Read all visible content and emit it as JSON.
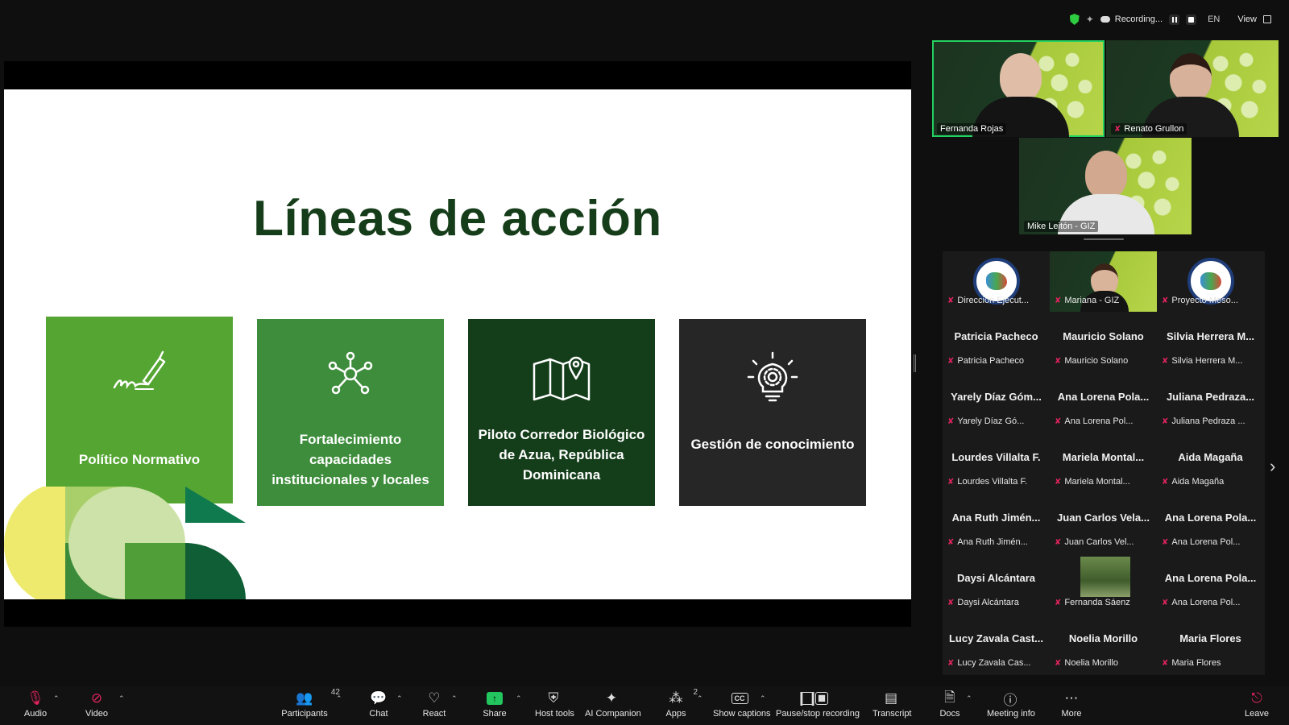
{
  "topbar": {
    "recording": "Recording...",
    "language": "EN",
    "view": "View"
  },
  "slide": {
    "title": "Líneas de acción",
    "cards": [
      {
        "label": "Político Normativo",
        "icon": "signature-pen-icon"
      },
      {
        "label": "Fortalecimiento capacidades institucionales y locales",
        "icon": "network-nodes-icon"
      },
      {
        "label": "Piloto Corredor Biológico de Azua, República Dominicana",
        "icon": "map-pin-icon"
      },
      {
        "label": "Gestión de conocimiento",
        "icon": "lightbulb-gear-icon"
      }
    ],
    "colors": {
      "title": "#163d1a",
      "card1": "#55a533",
      "card2": "#3e8d3c",
      "card3": "#143d1a",
      "card4": "#262626"
    }
  },
  "video_tiles": [
    {
      "name": "Fernanda Rojas",
      "active": true
    },
    {
      "name": "Renato Grullon",
      "muted": true
    },
    {
      "name": "Mike Leitón - GIZ"
    }
  ],
  "gallery": [
    {
      "big": "",
      "small": "Dirección Ejecut...",
      "type": "logo"
    },
    {
      "big": "",
      "small": "Mariana - GIZ",
      "type": "video"
    },
    {
      "big": "",
      "small": "Proyecto Meso...",
      "type": "logo"
    },
    {
      "big": "Patricia Pacheco",
      "small": "Patricia Pacheco"
    },
    {
      "big": "Mauricio Solano",
      "small": "Mauricio Solano"
    },
    {
      "big": "Silvia Herrera M...",
      "small": "Silvia Herrera M..."
    },
    {
      "big": "Yarely Díaz Góm...",
      "small": "Yarely Díaz Gó..."
    },
    {
      "big": "Ana Lorena Pola...",
      "small": "Ana Lorena Pol..."
    },
    {
      "big": "Juliana Pedraza...",
      "small": "Juliana Pedraza ..."
    },
    {
      "big": "Lourdes Villalta F.",
      "small": "Lourdes Villalta F."
    },
    {
      "big": "Mariela Montal...",
      "small": "Mariela Montal..."
    },
    {
      "big": "Aida Magaña",
      "small": "Aida Magaña"
    },
    {
      "big": "Ana Ruth Jimén...",
      "small": "Ana Ruth Jimén..."
    },
    {
      "big": "Juan Carlos Vela...",
      "small": "Juan Carlos Vel..."
    },
    {
      "big": "Ana Lorena Pola...",
      "small": "Ana Lorena Pol..."
    },
    {
      "big": "Daysi Alcántara",
      "small": "Daysi Alcántara"
    },
    {
      "big": "",
      "small": "Fernanda Sáenz",
      "type": "photo"
    },
    {
      "big": "Ana Lorena Pola...",
      "small": "Ana Lorena Pol..."
    },
    {
      "big": "Lucy Zavala Cast...",
      "small": "Lucy Zavala Cas..."
    },
    {
      "big": "Noelia Morillo",
      "small": "Noelia Morillo"
    },
    {
      "big": "Maria Flores",
      "small": "Maria Flores"
    }
  ],
  "toolbar": {
    "audio": "Audio",
    "video": "Video",
    "participants": "Participants",
    "participants_count": "42",
    "chat": "Chat",
    "react": "React",
    "share": "Share",
    "host_tools": "Host tools",
    "ai_companion": "AI Companion",
    "apps": "Apps",
    "apps_count": "2",
    "show_captions": "Show captions",
    "pause_stop_recording": "Pause/stop recording",
    "transcript": "Transcript",
    "docs": "Docs",
    "meeting_info": "Meeting info",
    "more": "More",
    "leave": "Leave"
  }
}
